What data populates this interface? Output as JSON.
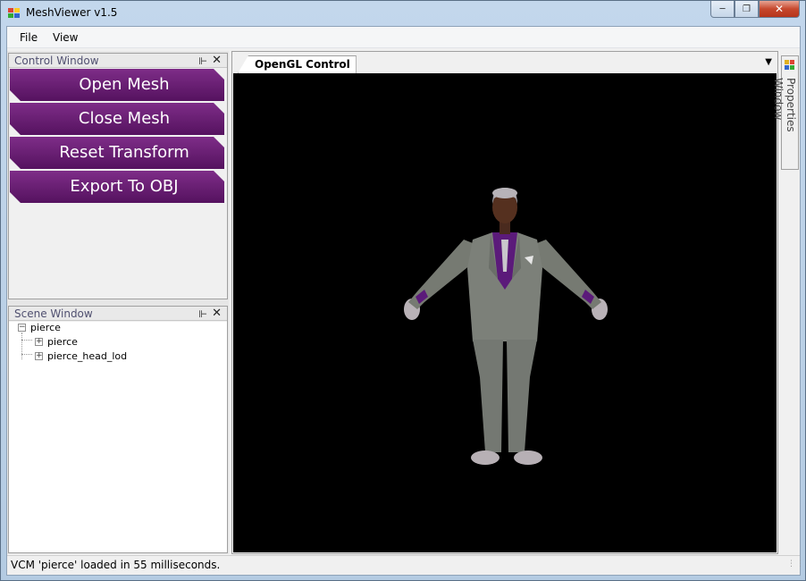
{
  "window": {
    "title": "MeshViewer v1.5"
  },
  "menu": {
    "items": [
      "File",
      "View"
    ]
  },
  "control_window": {
    "title": "Control Window",
    "buttons": [
      "Open Mesh",
      "Close Mesh",
      "Reset Transform",
      "Export To OBJ"
    ]
  },
  "scene_window": {
    "title": "Scene Window",
    "tree": {
      "root": "pierce",
      "children": [
        "pierce",
        "pierce_head_lod"
      ]
    }
  },
  "document": {
    "tab_label": "OpenGL Control"
  },
  "properties_window": {
    "label": "Properties Window"
  },
  "status": {
    "text": "VCM 'pierce' loaded in 55 milliseconds."
  },
  "colors": {
    "button_purple": "#6a1e75",
    "viewport_bg": "#000000",
    "accent_purple": "#5b1a7a"
  },
  "icons": [
    "app-icon",
    "minimize-icon",
    "maximize-icon",
    "close-icon",
    "pin-icon",
    "panel-close-icon",
    "expand-icon",
    "dropdown-icon",
    "properties-icon",
    "resize-grip-icon"
  ]
}
